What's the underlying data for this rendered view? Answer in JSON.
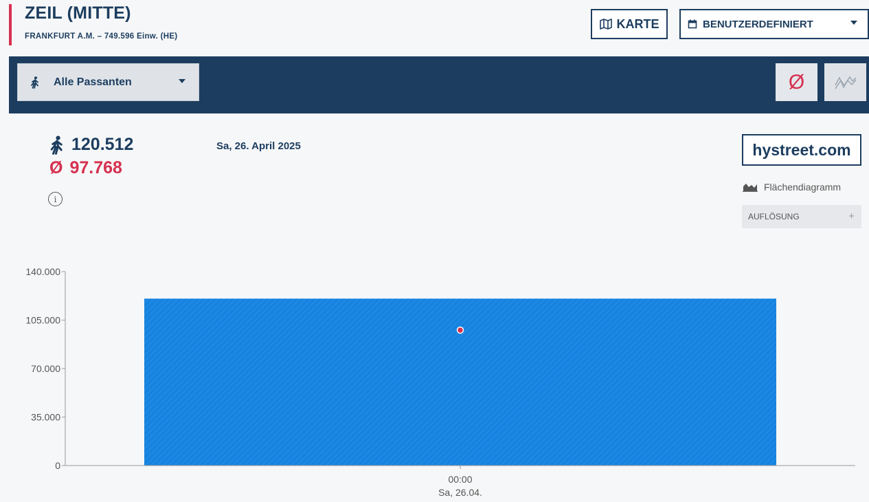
{
  "header": {
    "location_title": "ZEIL (MITTE)",
    "location_sub": "FRANKFURT A.M. – 749.596 Einw. (HE)",
    "map_button": "KARTE",
    "range_button": "BENUTZERDEFINIERT"
  },
  "navbar": {
    "filter_label": "Alle Passanten",
    "avg_button_symbol": "Ø"
  },
  "stats": {
    "count": "120.512",
    "average": "97.768",
    "avg_symbol": "Ø",
    "date": "Sa, 26. April 2025"
  },
  "sidebar": {
    "brand": "hystreet.com",
    "chart_type_label": "Flächendiagramm",
    "resolution_label": "AUFLÖSUNG",
    "resolution_toggle": "+"
  },
  "colors": {
    "accent": "#d6304f",
    "navy": "#1c3d5f",
    "bar": "#1683e0"
  },
  "icons": {
    "map": "map-icon",
    "calendar": "calendar-icon",
    "pedestrian": "pedestrian-icon",
    "average": "average-icon",
    "compare": "compare-lines-icon",
    "info": "info-icon",
    "area_chart": "area-chart-icon"
  },
  "chart_data": {
    "type": "bar",
    "categories": [
      "00:00\nSa, 26.04."
    ],
    "tick_line1": "00:00",
    "tick_line2": "Sa, 26.04.",
    "values": [
      120512
    ],
    "average_marker": 97768,
    "ylim": [
      0,
      140000
    ],
    "yticks": [
      0,
      35000,
      70000,
      105000,
      140000
    ],
    "ytick_labels": [
      "0",
      "35.000",
      "70.000",
      "105.000",
      "140.000"
    ],
    "grid": false
  }
}
